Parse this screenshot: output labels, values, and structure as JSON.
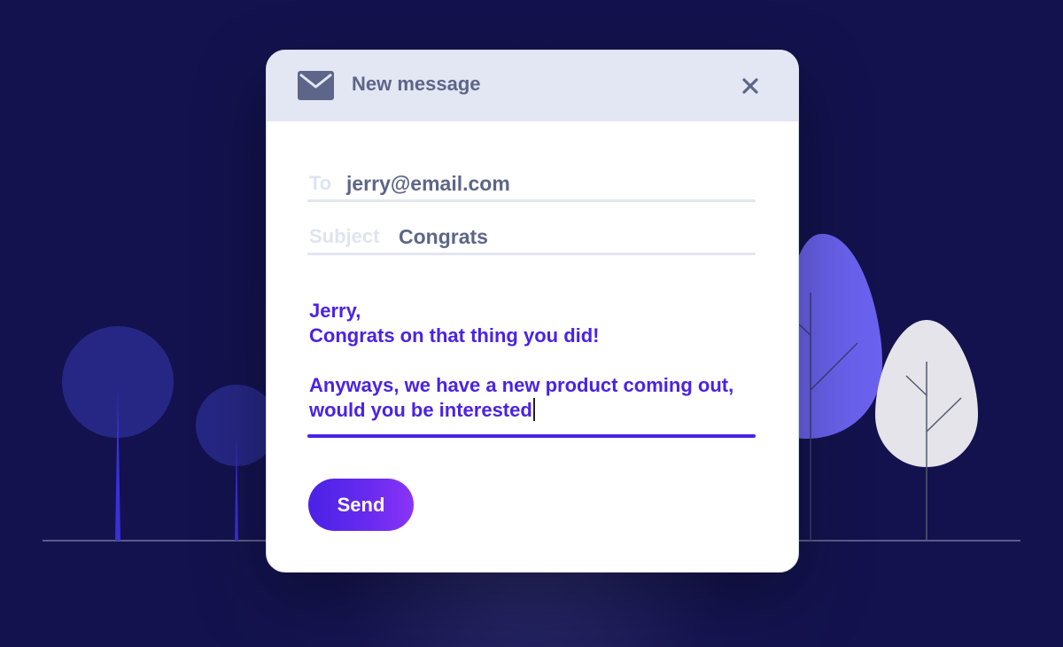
{
  "window": {
    "title": "New message"
  },
  "icons": {
    "mail": "mail-icon",
    "close": "close-icon"
  },
  "to": {
    "label": "To",
    "value": "jerry@email.com"
  },
  "subject": {
    "label": "Subject",
    "value": "Congrats"
  },
  "body": {
    "lines": [
      "Jerry,",
      "Congrats on that thing you did!",
      "",
      "Anyways, we have a new product coming out,",
      "would you be interested"
    ]
  },
  "send": {
    "label": "Send"
  },
  "colors": {
    "background": "#13124e",
    "accent": "#4a22e6",
    "titlebar": "#e3e7f3",
    "muted_text": "#5d6688"
  }
}
